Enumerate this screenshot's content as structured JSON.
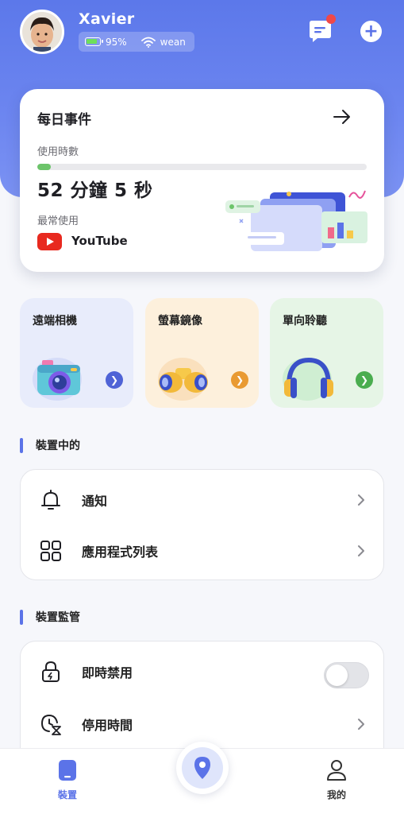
{
  "header": {
    "user_name": "Xavier",
    "battery": "95%",
    "wifi": "wean"
  },
  "daily": {
    "title": "每日事件",
    "usage_label": "使用時數",
    "usage_progress": 0.04,
    "usage_time": "52 分鐘 5 秒",
    "most_used_label": "最常使用",
    "most_used_app": "YouTube"
  },
  "features": [
    {
      "label": "遠端相機",
      "accent": "#4f63d6"
    },
    {
      "label": "螢幕鏡像",
      "accent": "#e99a32"
    },
    {
      "label": "單向聆聽",
      "accent": "#4aad4f"
    }
  ],
  "sections": {
    "device": {
      "title": "裝置中的",
      "items": [
        {
          "label": "通知",
          "icon": "bell-icon"
        },
        {
          "label": "應用程式列表",
          "icon": "grid-icon"
        }
      ]
    },
    "control": {
      "title": "裝置監管",
      "items": [
        {
          "label": "即時禁用",
          "icon": "lock-icon",
          "toggle_on": false
        },
        {
          "label": "停用時間",
          "icon": "clock-icon"
        }
      ]
    }
  },
  "nav": {
    "device": "裝置",
    "me": "我的"
  },
  "colors": {
    "primary": "#5b73e8",
    "notification_dot": "#f04848",
    "progress": "#6cc46a"
  }
}
